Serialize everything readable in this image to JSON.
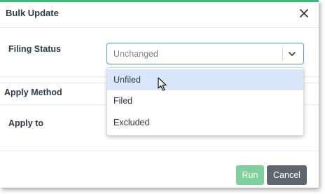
{
  "dialog": {
    "title": "Bulk Update",
    "close_icon": "close-icon",
    "accent_color": "#3cb878"
  },
  "form": {
    "filing_status_label": "Filing Status",
    "apply_method_label": "Apply Method",
    "apply_to_label": "Apply to",
    "filing_status_select": {
      "value": "Unchanged",
      "chevron_icon": "chevron-down-icon",
      "options": [
        {
          "label": "Unfiled",
          "highlighted": true
        },
        {
          "label": "Filed",
          "highlighted": false
        },
        {
          "label": "Excluded",
          "highlighted": false
        }
      ]
    }
  },
  "footer": {
    "run_label": "Run",
    "cancel_label": "Cancel",
    "run_color": "#7fcf9a",
    "cancel_color": "#5f656c"
  },
  "cursor_icon": "mouse-pointer-icon"
}
